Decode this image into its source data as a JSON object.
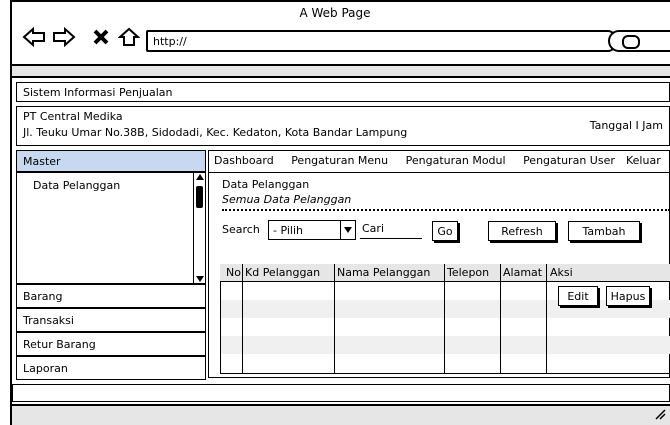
{
  "browser": {
    "title": "A Web Page",
    "url": "http://"
  },
  "app": {
    "title": "Sistem Informasi Penjualan",
    "company": "PT Central Medika",
    "address": "Jl. Teuku Umar No.38B, Sidodadi, Kec. Kedaton, Kota Bandar Lampung",
    "date_label": "Tanggal I Jam"
  },
  "sidebar": {
    "head": "Master",
    "sub_items": [
      "Data Pelanggan"
    ],
    "items": [
      "Barang",
      "Transaksi",
      "Retur Barang",
      "Laporan"
    ]
  },
  "menu": {
    "items": [
      "Dashboard",
      "Pengaturan Menu",
      "Pengaturan Modul",
      "Pengaturan User"
    ],
    "logout": "Keluar"
  },
  "content": {
    "heading": "Data Pelanggan",
    "subheading": "Semua Data Pelanggan",
    "search_label": "Search",
    "select_value": "- Pilih",
    "cari_label": "Cari",
    "go_label": "Go",
    "refresh_label": "Refresh",
    "tambah_label": "Tambah"
  },
  "table": {
    "columns": [
      "No",
      "Kd Pelanggan",
      "Nama Pelanggan",
      "Telepon",
      "Alamat",
      "Aksi"
    ],
    "edit_label": "Edit",
    "hapus_label": "Hapus"
  }
}
